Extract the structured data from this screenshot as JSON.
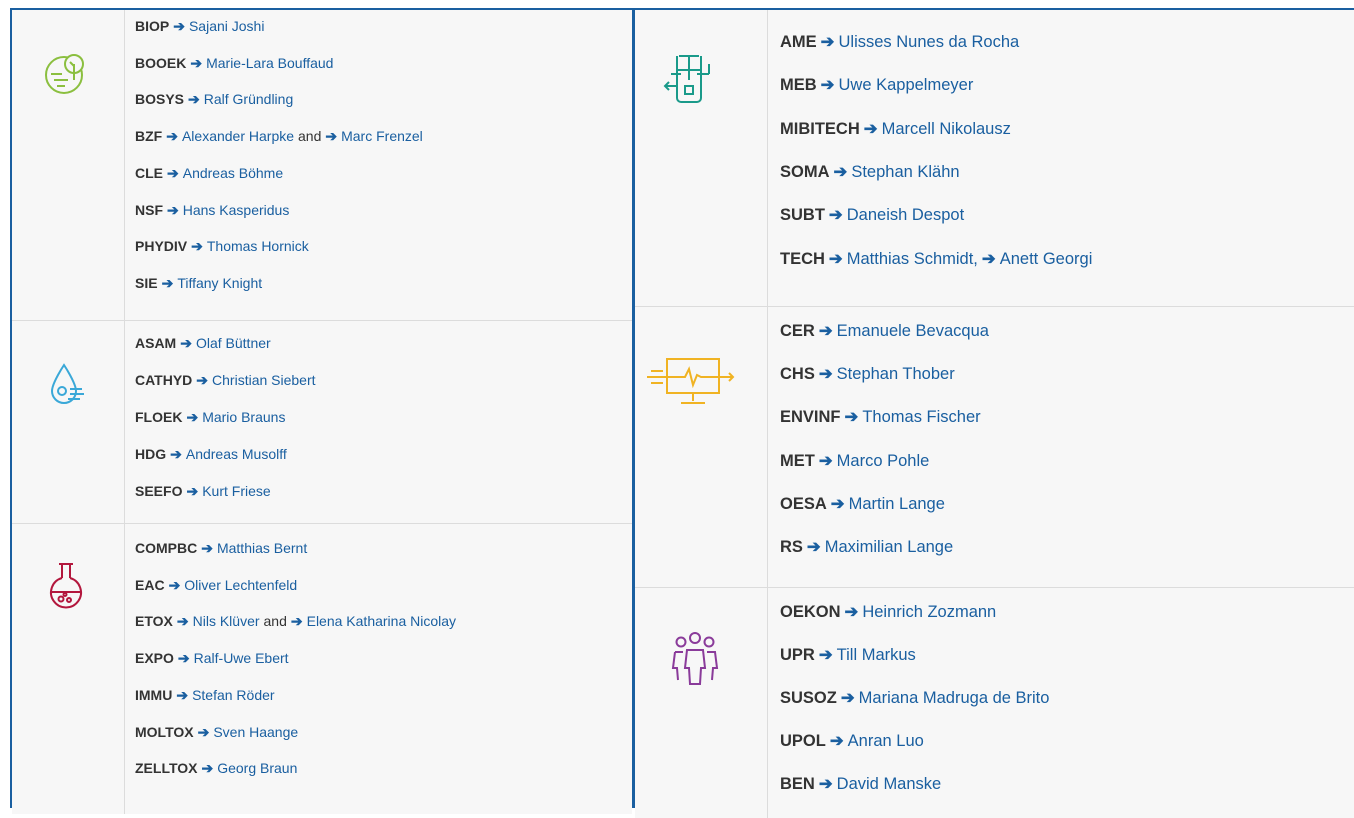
{
  "left_groups": [
    {
      "icon": "plant-circle-icon",
      "icon_color": "#8bbf3f",
      "rows": [
        {
          "code": "BIOP",
          "names": [
            "Sajani Joshi"
          ],
          "sep": ""
        },
        {
          "code": "BOOEK",
          "names": [
            "Marie-Lara Bouffaud"
          ],
          "sep": ""
        },
        {
          "code": "BOSYS",
          "names": [
            "Ralf Gründling"
          ],
          "sep": ""
        },
        {
          "code": "BZF",
          "names": [
            "Alexander Harpke",
            "Marc Frenzel"
          ],
          "sep": "and"
        },
        {
          "code": "CLE",
          "names": [
            "Andreas Böhme"
          ],
          "sep": ""
        },
        {
          "code": "NSF",
          "names": [
            "Hans Kasperidus"
          ],
          "sep": ""
        },
        {
          "code": "PHYDIV",
          "names": [
            "Thomas Hornick"
          ],
          "sep": ""
        },
        {
          "code": "SIE",
          "names": [
            "Tiffany Knight"
          ],
          "sep": ""
        }
      ]
    },
    {
      "icon": "water-drop-icon",
      "icon_color": "#3aa8d8",
      "rows": [
        {
          "code": "ASAM",
          "names": [
            "Olaf Büttner"
          ],
          "sep": ""
        },
        {
          "code": "CATHYD",
          "names": [
            "Christian Siebert"
          ],
          "sep": ""
        },
        {
          "code": "FLOEK",
          "names": [
            "Mario Brauns"
          ],
          "sep": ""
        },
        {
          "code": "HDG",
          "names": [
            "Andreas Musolff"
          ],
          "sep": ""
        },
        {
          "code": "SEEFO",
          "names": [
            "Kurt Friese"
          ],
          "sep": ""
        }
      ]
    },
    {
      "icon": "flask-icon",
      "icon_color": "#b3173d",
      "rows": [
        {
          "code": "COMPBC",
          "names": [
            "Matthias Bernt"
          ],
          "sep": ""
        },
        {
          "code": "EAC",
          "names": [
            "Oliver Lechtenfeld"
          ],
          "sep": ""
        },
        {
          "code": "ETOX",
          "names": [
            "Nils Klüver",
            "Elena Katharina Nicolay"
          ],
          "sep": "and"
        },
        {
          "code": "EXPO",
          "names": [
            "Ralf-Uwe Ebert"
          ],
          "sep": ""
        },
        {
          "code": "IMMU",
          "names": [
            "Stefan Röder"
          ],
          "sep": ""
        },
        {
          "code": "MOLTOX",
          "names": [
            "Sven Haange"
          ],
          "sep": ""
        },
        {
          "code": "ZELLTOX",
          "names": [
            "Georg Braun"
          ],
          "sep": ""
        }
      ]
    }
  ],
  "right_groups": [
    {
      "icon": "bioreactor-icon",
      "icon_color": "#1a9a8a",
      "rows": [
        {
          "code": "AME",
          "names": [
            "Ulisses Nunes da Rocha"
          ],
          "sep": ""
        },
        {
          "code": "MEB",
          "names": [
            "Uwe Kappelmeyer"
          ],
          "sep": ""
        },
        {
          "code": "MIBITECH",
          "names": [
            "Marcell Nikolausz"
          ],
          "sep": ""
        },
        {
          "code": "SOMA",
          "names": [
            "Stephan Klähn"
          ],
          "sep": ""
        },
        {
          "code": "SUBT",
          "names": [
            "Daneish Despot"
          ],
          "sep": ""
        },
        {
          "code": "TECH",
          "names": [
            "Matthias Schmidt,",
            "Anett Georgi"
          ],
          "sep": ""
        }
      ]
    },
    {
      "icon": "monitor-signal-icon",
      "icon_color": "#f0b323",
      "rows": [
        {
          "code": "CER",
          "names": [
            "Emanuele Bevacqua"
          ],
          "sep": ""
        },
        {
          "code": "CHS",
          "names": [
            "Stephan Thober"
          ],
          "sep": ""
        },
        {
          "code": "ENVINF",
          "names": [
            "Thomas Fischer"
          ],
          "sep": ""
        },
        {
          "code": "MET",
          "names": [
            "Marco Pohle"
          ],
          "sep": ""
        },
        {
          "code": "OESA",
          "names": [
            "Martin Lange"
          ],
          "sep": ""
        },
        {
          "code": "RS",
          "names": [
            "Maximilian Lange"
          ],
          "sep": ""
        }
      ]
    },
    {
      "icon": "people-group-icon",
      "icon_color": "#8a3b9a",
      "rows": [
        {
          "code": "OEKON",
          "names": [
            "Heinrich Zozmann"
          ],
          "sep": ""
        },
        {
          "code": "UPR",
          "names": [
            "Till Markus"
          ],
          "sep": ""
        },
        {
          "code": "SUSOZ",
          "names": [
            "Mariana Madruga de Brito"
          ],
          "sep": ""
        },
        {
          "code": "UPOL",
          "names": [
            "Anran Luo"
          ],
          "sep": ""
        },
        {
          "code": "BEN",
          "names": [
            "David Manske"
          ],
          "sep": ""
        }
      ]
    }
  ],
  "arrow_glyph": "➔"
}
